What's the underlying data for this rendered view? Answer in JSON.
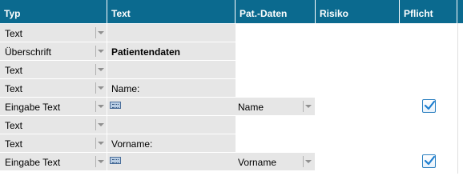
{
  "headers": {
    "typ": "Typ",
    "text": "Text",
    "pat": "Pat.-Daten",
    "risiko": "Risiko",
    "pflicht": "Pflicht"
  },
  "rows": [
    {
      "typ": "Text",
      "text": "",
      "text_bold": false,
      "text_input_icon": false,
      "pat": "",
      "pflicht": false
    },
    {
      "typ": "Überschrift",
      "text": "Patientendaten",
      "text_bold": true,
      "text_input_icon": false,
      "pat": "",
      "pflicht": false
    },
    {
      "typ": "Text",
      "text": "",
      "text_bold": false,
      "text_input_icon": false,
      "pat": "",
      "pflicht": false
    },
    {
      "typ": "Text",
      "text": "Name:",
      "text_bold": false,
      "text_input_icon": false,
      "pat": "",
      "pflicht": false
    },
    {
      "typ": "Eingabe Text",
      "text": "",
      "text_bold": false,
      "text_input_icon": true,
      "pat": "Name",
      "pflicht": true
    },
    {
      "typ": "Text",
      "text": "",
      "text_bold": false,
      "text_input_icon": false,
      "pat": "",
      "pflicht": false
    },
    {
      "typ": "Text",
      "text": "Vorname:",
      "text_bold": false,
      "text_input_icon": false,
      "pat": "",
      "pflicht": false
    },
    {
      "typ": "Eingabe Text",
      "text": "",
      "text_bold": false,
      "text_input_icon": true,
      "pat": "Vorname",
      "pflicht": true
    }
  ],
  "icons": {
    "dropdown": "chevron-down-icon",
    "input_field": "keyboard-icon",
    "checkbox": "checkmark-icon"
  },
  "colors": {
    "header_bg": "#0b6a8f",
    "cell_bg": "#e6e6e6",
    "checkbox_border": "#2a7fc0",
    "checkmark": "#1e7fd0"
  }
}
